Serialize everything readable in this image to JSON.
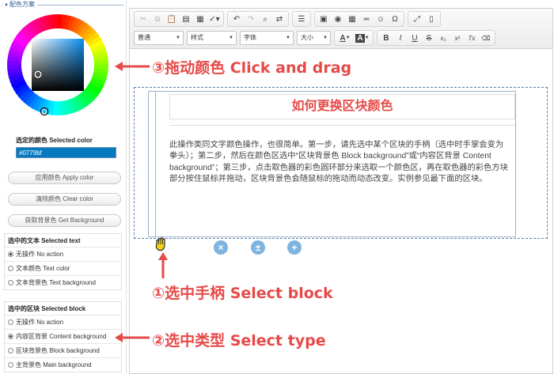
{
  "panel": {
    "title": "配色方案",
    "selected_color_label": "选定的颜色 Selected color",
    "selected_color_value": "#0779bf",
    "buttons": {
      "apply": "应用颜色 Apply color",
      "clear": "清除颜色 Clear color",
      "get_background": "获取背景色 Get Background"
    },
    "selected_text": {
      "title": "选中的文本 Selected text",
      "options": [
        "无操作 No action",
        "文本颜色 Text color",
        "文本背景色 Text background"
      ],
      "checked_index": 0
    },
    "selected_block": {
      "title": "选中的区块 Selected block",
      "options": [
        "无操作 No action",
        "内容区背景 Content background",
        "区块背景色 Block background",
        "主背景色 Main background"
      ],
      "checked_index": 1
    }
  },
  "toolbar": {
    "combos": {
      "format": "普通",
      "styles": "样式",
      "font": "字体",
      "size": "大小"
    },
    "text_color_letter": "A",
    "bg_color_letter": "A",
    "bold": "B",
    "italic": "I",
    "underline": "U",
    "strike": "S",
    "subscript": "x₂",
    "superscript": "x²",
    "clear_format": "Tx"
  },
  "content": {
    "heading": "如何更换区块颜色",
    "body": "此操作类同文字颜色操作，也很简单。第一步，请先选中某个区块的手柄（选中时手掌会变为拳头）；第二步，然后在颜色区选中“区块背景色 Block background”或“内容区背景 Content background”；第三步，点击取色器的彩色圆环部分来选取一个颜色区，再在取色器的彩色方块部分按住鼠标并拖动，区块背景色会随鼠标的拖动而动态改变。实例参见最下面的区块。"
  },
  "block_actions": [
    "×",
    "±",
    "+"
  ],
  "annotations": {
    "drag": "③拖动颜色 Click and drag",
    "select_block": "①选中手柄 Select block",
    "select_type": "②选中类型 Select type"
  },
  "colors": {
    "accent_red": "#e64a48",
    "selected_color": "#0779bf",
    "heading_color": "#e64a48",
    "action_blue": "#7fb4e0"
  }
}
